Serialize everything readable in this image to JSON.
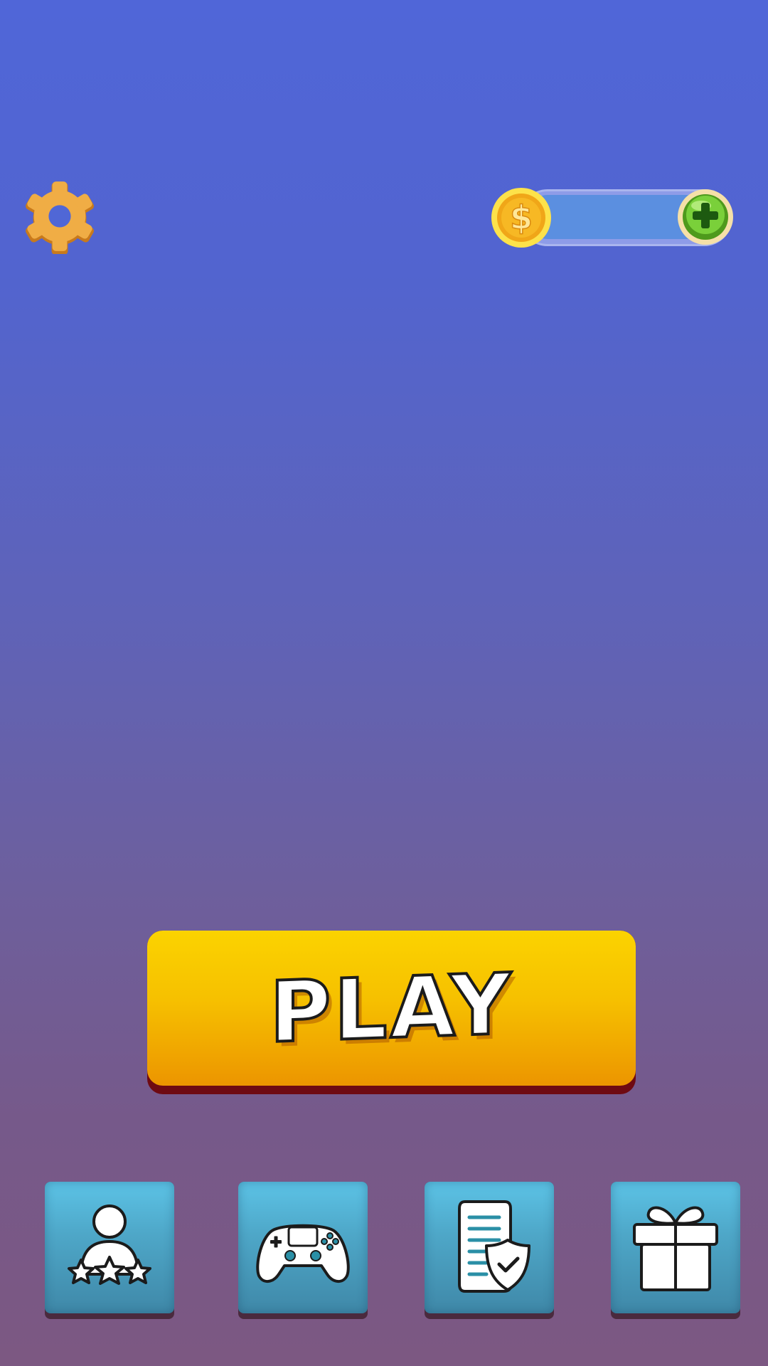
{
  "header": {
    "settings_icon": "gear-icon",
    "coin_icon": "dollar-coin-icon",
    "coin_balance": "",
    "add_coins_icon": "green-plus-icon"
  },
  "main": {
    "play_label": "PLAY"
  },
  "bottom_menu": {
    "items": [
      {
        "icon": "profile-stars-icon"
      },
      {
        "icon": "gamepad-icon"
      },
      {
        "icon": "privacy-policy-icon"
      },
      {
        "icon": "gift-icon"
      }
    ]
  },
  "colors": {
    "background_top": "#5066d8",
    "background_bottom": "#7c5882",
    "play_button": "#f6c000",
    "tile": "#4ea7c8",
    "gear": "#e8a436"
  }
}
